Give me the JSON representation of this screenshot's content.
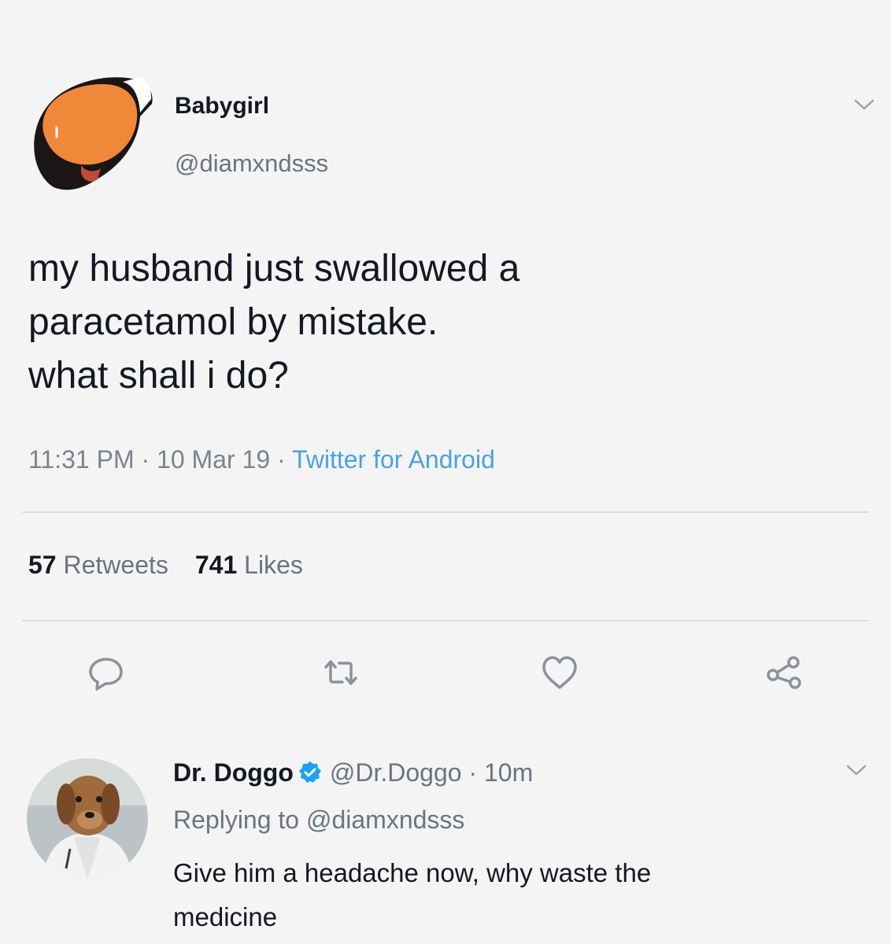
{
  "tweet": {
    "display_name": "Babygirl",
    "handle": "@diamxndsss",
    "text_lines": [
      "my husband just swallowed a",
      "paracetamol by mistake.",
      "what shall i do?"
    ],
    "time": "11:31 PM",
    "date": "10 Mar 19",
    "source": "Twitter for Android",
    "separator": " · ",
    "retweets_count": "57",
    "retweets_label": "Retweets",
    "likes_count": "741",
    "likes_label": "Likes",
    "avatar_icon": "profile-avatar-icon",
    "menu_icon": "chevron-down-icon"
  },
  "actions": {
    "reply_icon": "reply-icon",
    "retweet_icon": "retweet-icon",
    "like_icon": "heart-icon",
    "share_icon": "share-icon"
  },
  "reply": {
    "display_name": "Dr. Doggo",
    "verified_icon": "verified-badge-icon",
    "handle": "@Dr.Doggo",
    "separator": " · ",
    "time": "10m",
    "replying_prefix": "Replying to",
    "replying_to": "@diamxndsss",
    "text_lines": [
      "Give him a headache now, why waste the",
      "medicine"
    ],
    "avatar_icon": "dog-avatar-icon"
  },
  "colors": {
    "background": "#f4f4f4",
    "text": "#141823",
    "secondary": "#6b7480",
    "link": "#4aa3df",
    "verified": "#1da1f2",
    "avatar_orange": "#f0883a"
  }
}
